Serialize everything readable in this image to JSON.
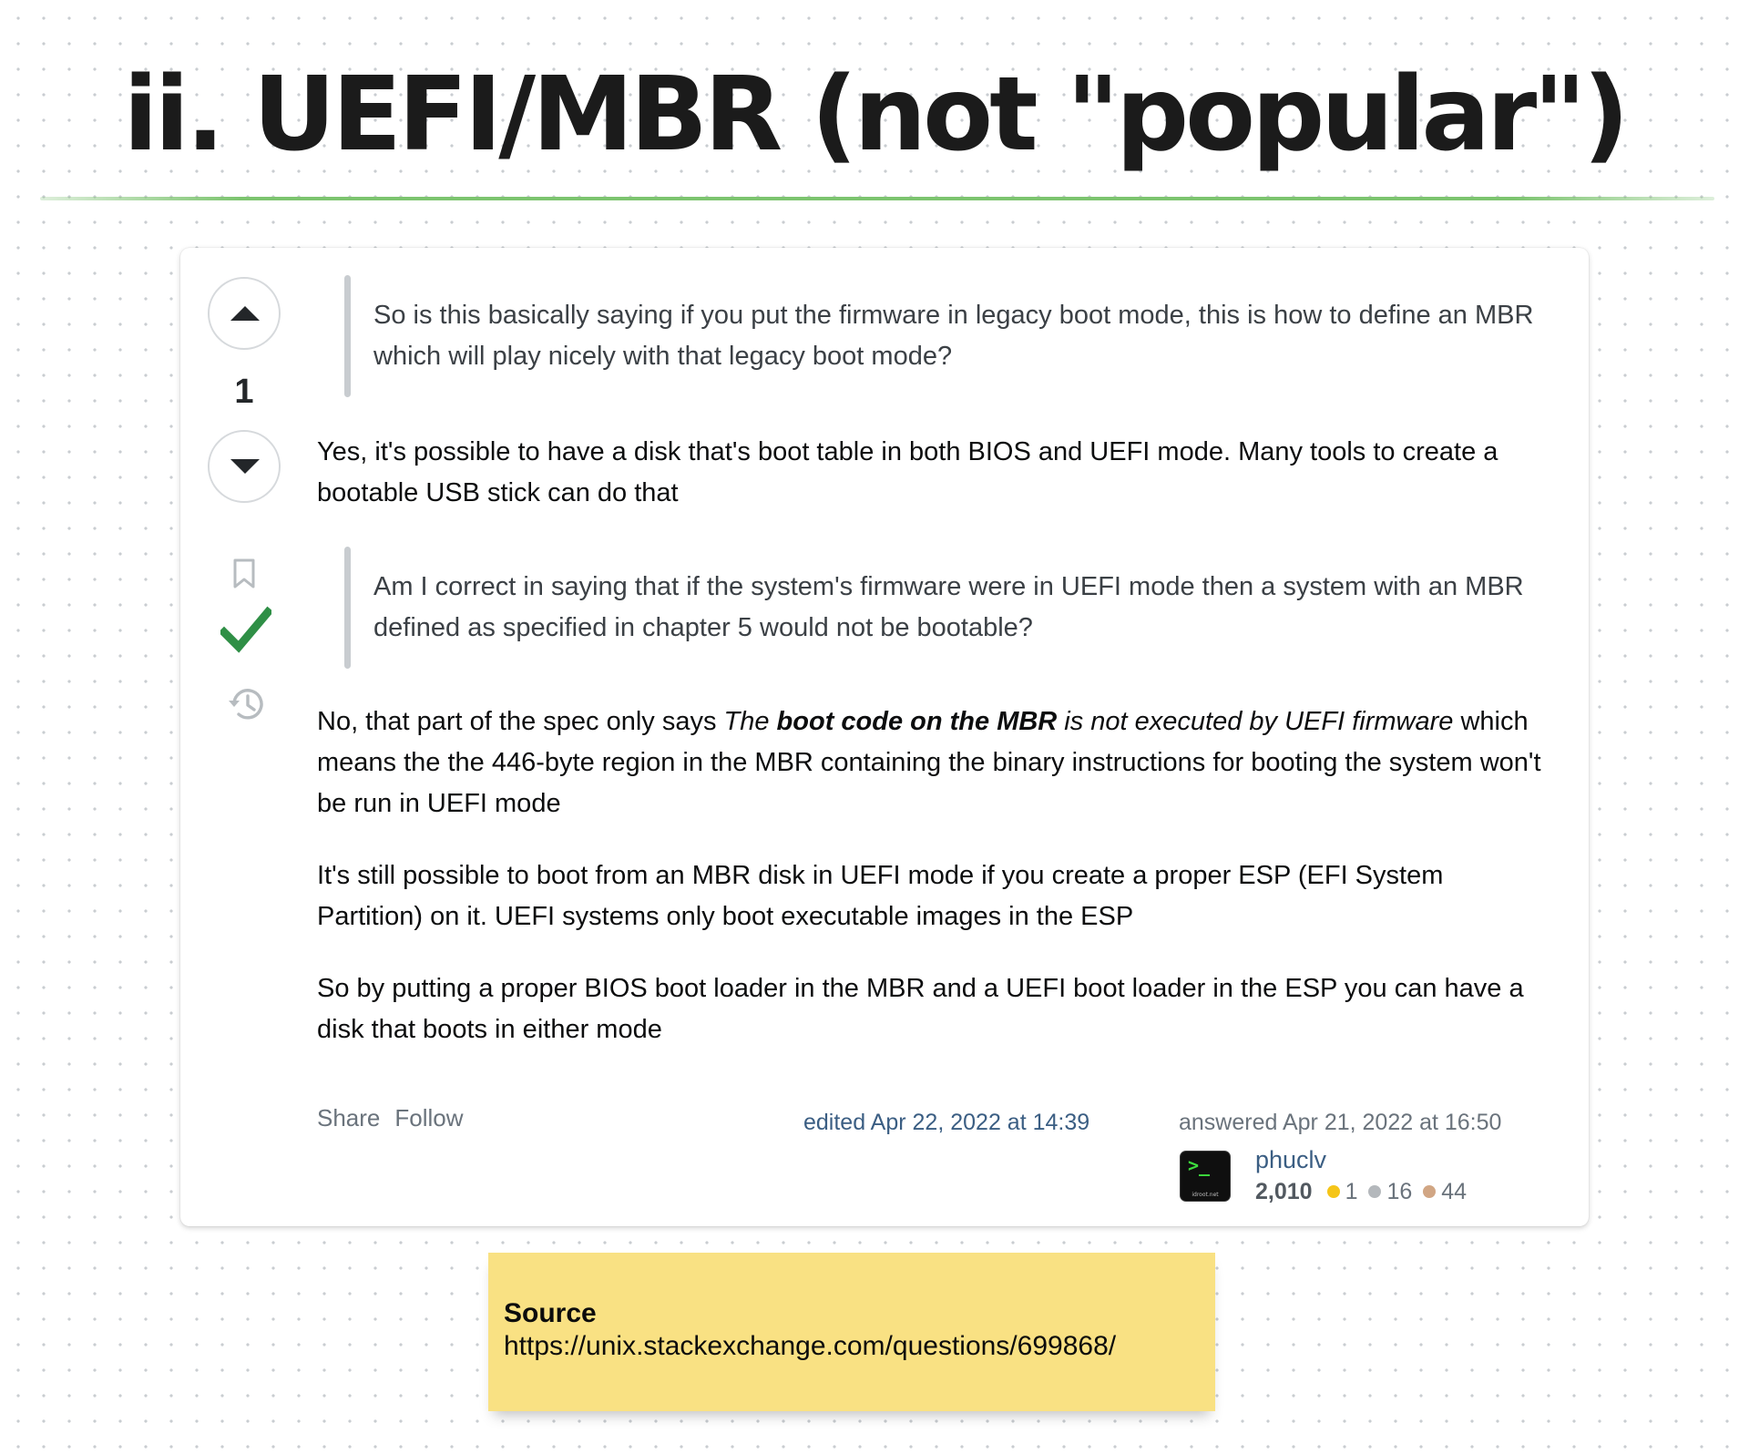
{
  "slide": {
    "title": "ii. UEFI/MBR (not \"popular\")"
  },
  "answer": {
    "vote_count": "1",
    "quote_1": "So is this basically saying if you put the firmware in legacy boot mode, this is how to define an MBR which will play nicely with that legacy boot mode?",
    "para_1": "Yes, it's possible to have a disk that's boot table in both BIOS and UEFI mode. Many tools to create a bootable USB stick can do that",
    "quote_2": "Am I correct in saying that if the system's firmware were in UEFI mode then a system with an MBR defined as specified in chapter 5 would not be bootable?",
    "para_2": {
      "lead": "No, that part of the spec only says ",
      "em_1": "The ",
      "em_strong": "boot code on the MBR",
      "em_2": " is not executed by UEFI firmware",
      "tail": " which means the the 446-byte region in the MBR containing the binary instructions for booting the system won't be run in UEFI mode"
    },
    "para_3": "It's still possible to boot from an MBR disk in UEFI mode if you create a proper ESP (EFI System Partition) on it. UEFI systems only boot executable images in the ESP",
    "para_4": "So by putting a proper BIOS boot loader in the MBR and a UEFI boot loader in the ESP you can have a disk that boots in either mode",
    "actions": {
      "share": "Share",
      "follow": "Follow"
    },
    "edited": "edited Apr 22, 2022 at 14:39",
    "answered": "answered Apr 21, 2022 at 16:50",
    "user": {
      "name": "phuclv",
      "avatar_prompt": ">_",
      "avatar_site": "idroot.net",
      "reputation": "2,010",
      "gold": "1",
      "silver": "16",
      "bronze": "44"
    }
  },
  "source": {
    "label": "Source",
    "url": "https://unix.stackexchange.com/questions/699868/"
  },
  "colors": {
    "accepted": "#2f8f46",
    "gold_badge": "#f5c518",
    "silver_badge": "#b4b8bc",
    "bronze_badge": "#d1a684",
    "link": "#3b5e83",
    "title_rule": "#7cc46f",
    "note": "#f9e183"
  },
  "icons": [
    "upvote-icon",
    "downvote-icon",
    "bookmark-icon",
    "accepted-check-icon",
    "history-icon"
  ]
}
